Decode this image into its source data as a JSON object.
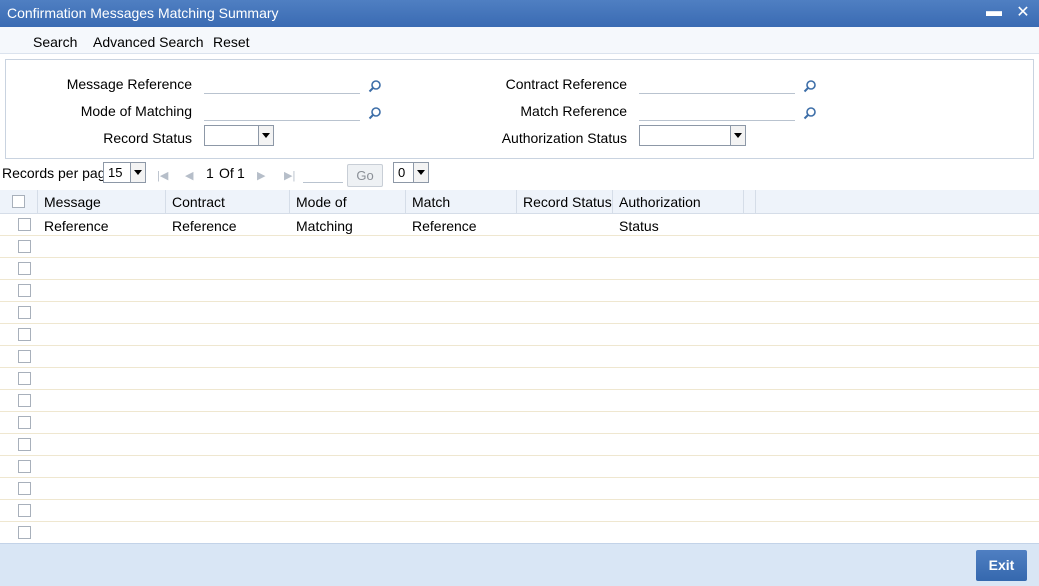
{
  "window": {
    "title": "Confirmation Messages Matching Summary"
  },
  "menu": {
    "search": "Search",
    "advanced_search": "Advanced Search",
    "reset": "Reset"
  },
  "criteria": {
    "message_reference": {
      "label": "Message Reference",
      "value": ""
    },
    "contract_reference": {
      "label": "Contract Reference",
      "value": ""
    },
    "mode_of_matching": {
      "label": "Mode of Matching",
      "value": ""
    },
    "match_reference": {
      "label": "Match Reference",
      "value": ""
    },
    "record_status": {
      "label": "Record Status",
      "value": ""
    },
    "authorization_status": {
      "label": "Authorization Status",
      "value": ""
    }
  },
  "pager": {
    "records_per_page_label": "Records per page",
    "records_per_page": "15",
    "current_page": "1",
    "of_label": "Of",
    "total_pages": "1",
    "go_label": "Go",
    "extra_select": "0"
  },
  "grid": {
    "columns": [
      "Message Reference",
      "Contract Reference",
      "Mode of Matching",
      "Match Reference",
      "Record Status",
      "Authorization Status"
    ],
    "row_count": 15
  },
  "footer": {
    "exit_label": "Exit"
  },
  "icons": {
    "search": "magnifier-icon",
    "dropdown": "chevron-down-icon"
  },
  "colors": {
    "titlebar": "#3a6bb3",
    "footer": "#d9e6f5",
    "exit_button": "#3d70b6"
  }
}
